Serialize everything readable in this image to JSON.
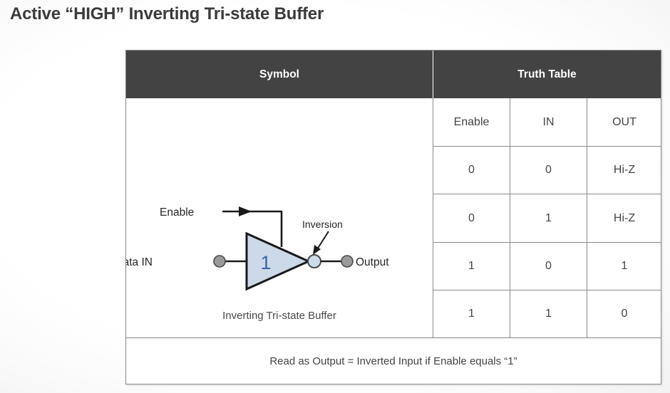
{
  "page": {
    "title": "Active “HIGH” Inverting Tri-state Buffer",
    "background_color": "#ffffff"
  },
  "table": {
    "header": {
      "symbol_label": "Symbol",
      "truth_table_label": "Truth Table",
      "background_color": "#434343",
      "text_color": "#ffffff"
    },
    "border_color": "#8a8a8a",
    "truth_table": {
      "columns": [
        "Enable",
        "IN",
        "OUT"
      ],
      "rows": [
        [
          "0",
          "0",
          "Hi-Z"
        ],
        [
          "0",
          "1",
          "Hi-Z"
        ],
        [
          "1",
          "0",
          "1"
        ],
        [
          "1",
          "1",
          "0"
        ]
      ]
    },
    "footer": {
      "note": "Read as Output = Inverted Input if Enable equals “1”"
    }
  },
  "symbol": {
    "caption": "Inverting Tri-state Buffer",
    "enable_label": "Enable",
    "data_in_label": "Data IN",
    "output_label": "Output",
    "inversion_label": "Inversion",
    "gate_number": "1",
    "gate_fill_color": "#ccd9e8",
    "gate_stroke_color": "#1a1a1a",
    "gate_number_color": "#3a62b0",
    "terminal_color": "#9a9a9a",
    "bubble_color": "#ccdcea"
  }
}
